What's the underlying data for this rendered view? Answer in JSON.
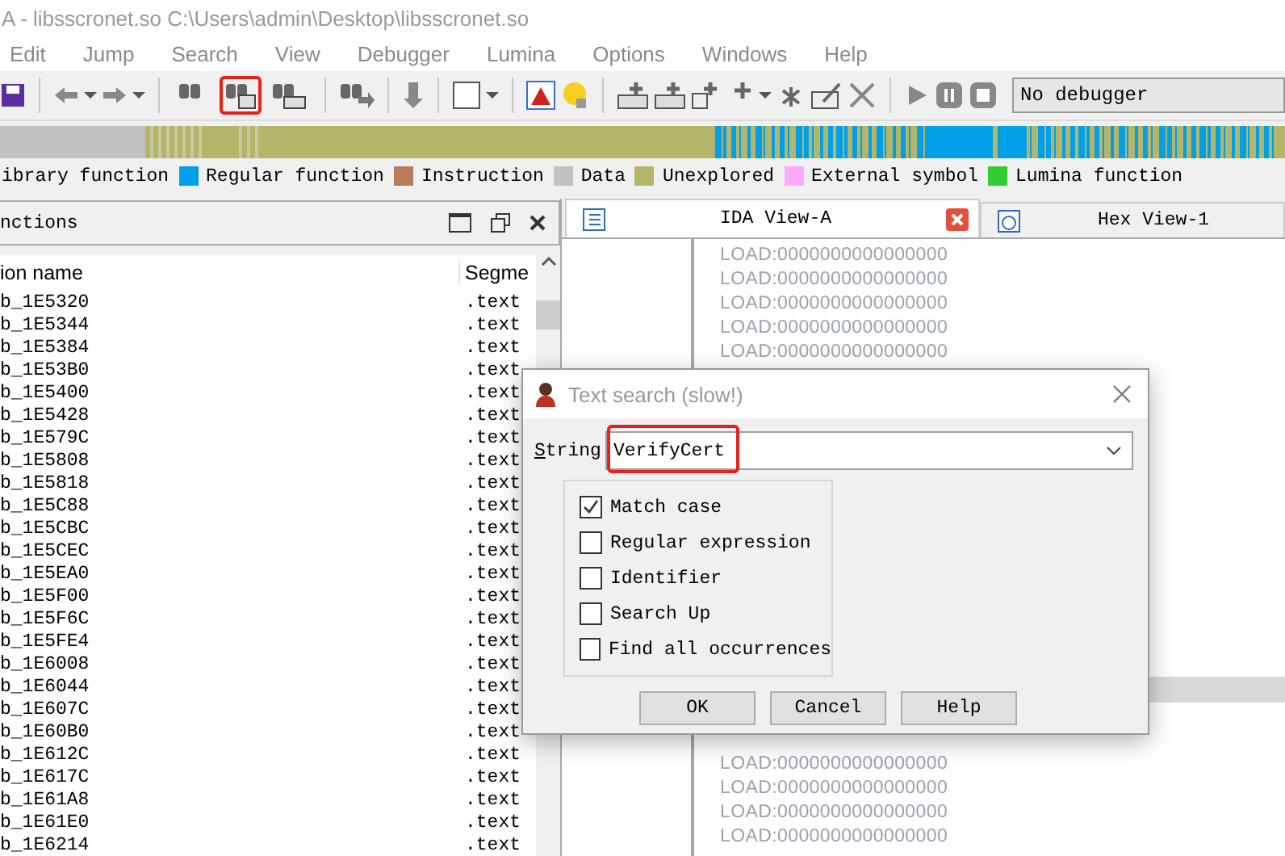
{
  "window": {
    "title": "A - libsscronet.so C:\\Users\\admin\\Desktop\\libsscronet.so"
  },
  "menu": [
    "Edit",
    "Jump",
    "Search",
    "View",
    "Debugger",
    "Lumina",
    "Options",
    "Windows",
    "Help"
  ],
  "toolbar": {
    "text_search_highlighted": true,
    "debugger": "No debugger"
  },
  "legend": [
    {
      "label": "ibrary function"
    },
    {
      "label": "Regular function",
      "color": "#00a0e8"
    },
    {
      "label": "Instruction",
      "color": "#b87b5a"
    },
    {
      "label": "Data",
      "color": "#c0c0c0"
    },
    {
      "label": "Unexplored",
      "color": "#b5b56a"
    },
    {
      "label": "External symbol",
      "color": "#ffa8ff"
    },
    {
      "label": "Lumina function",
      "color": "#33cc33"
    }
  ],
  "functions_panel": {
    "title": "nctions",
    "columns": [
      "ion name",
      "Segme"
    ],
    "rows": [
      {
        "name": "b_1E5320",
        "segment": ".text"
      },
      {
        "name": "b_1E5344",
        "segment": ".text"
      },
      {
        "name": "b_1E5384",
        "segment": ".text"
      },
      {
        "name": "b_1E53B0",
        "segment": ".text"
      },
      {
        "name": "b_1E5400",
        "segment": ".text"
      },
      {
        "name": "b_1E5428",
        "segment": ".text"
      },
      {
        "name": "b_1E579C",
        "segment": ".text"
      },
      {
        "name": "b_1E5808",
        "segment": ".text"
      },
      {
        "name": "b_1E5818",
        "segment": ".text"
      },
      {
        "name": "b_1E5C88",
        "segment": ".text"
      },
      {
        "name": "b_1E5CBC",
        "segment": ".text"
      },
      {
        "name": "b_1E5CEC",
        "segment": ".text"
      },
      {
        "name": "b_1E5EA0",
        "segment": ".text"
      },
      {
        "name": "b_1E5F00",
        "segment": ".text"
      },
      {
        "name": "b_1E5F6C",
        "segment": ".text"
      },
      {
        "name": "b_1E5FE4",
        "segment": ".text"
      },
      {
        "name": "b_1E6008",
        "segment": ".text"
      },
      {
        "name": "b_1E6044",
        "segment": ".text"
      },
      {
        "name": "b_1E607C",
        "segment": ".text"
      },
      {
        "name": "b_1E60B0",
        "segment": ".text"
      },
      {
        "name": "b_1E612C",
        "segment": ".text"
      },
      {
        "name": "b_1E617C",
        "segment": ".text"
      },
      {
        "name": "b_1E61A8",
        "segment": ".text"
      },
      {
        "name": "b_1E61E0",
        "segment": ".text"
      },
      {
        "name": "b_1E6214",
        "segment": ".text"
      }
    ]
  },
  "tabs": [
    {
      "label": "IDA View-A",
      "selected": true
    },
    {
      "label": "Hex View-1",
      "selected": false
    }
  ],
  "listing": {
    "rows_above": [
      "LOAD:0000000000000000",
      "LOAD:0000000000000000",
      "LOAD:0000000000000000",
      "LOAD:0000000000000000",
      "LOAD:0000000000000000"
    ],
    "rows_below": [
      "LOAD:0000000000000000",
      "LOAD:0000000000000000",
      "LOAD:0000000000000000",
      "LOAD:0000000000000000"
    ]
  },
  "dialog": {
    "title": "Text search (slow!)",
    "string_label": "String",
    "string_value": "VerifyCert",
    "string_highlighted": true,
    "options": [
      {
        "label": "Match case",
        "checked": true
      },
      {
        "label": "Regular expression",
        "checked": false
      },
      {
        "label": "Identifier",
        "checked": false
      },
      {
        "label": "Search Up",
        "checked": false
      },
      {
        "label": "Find all occurrences",
        "checked": false
      }
    ],
    "buttons": [
      "OK",
      "Cancel",
      "Help"
    ]
  }
}
